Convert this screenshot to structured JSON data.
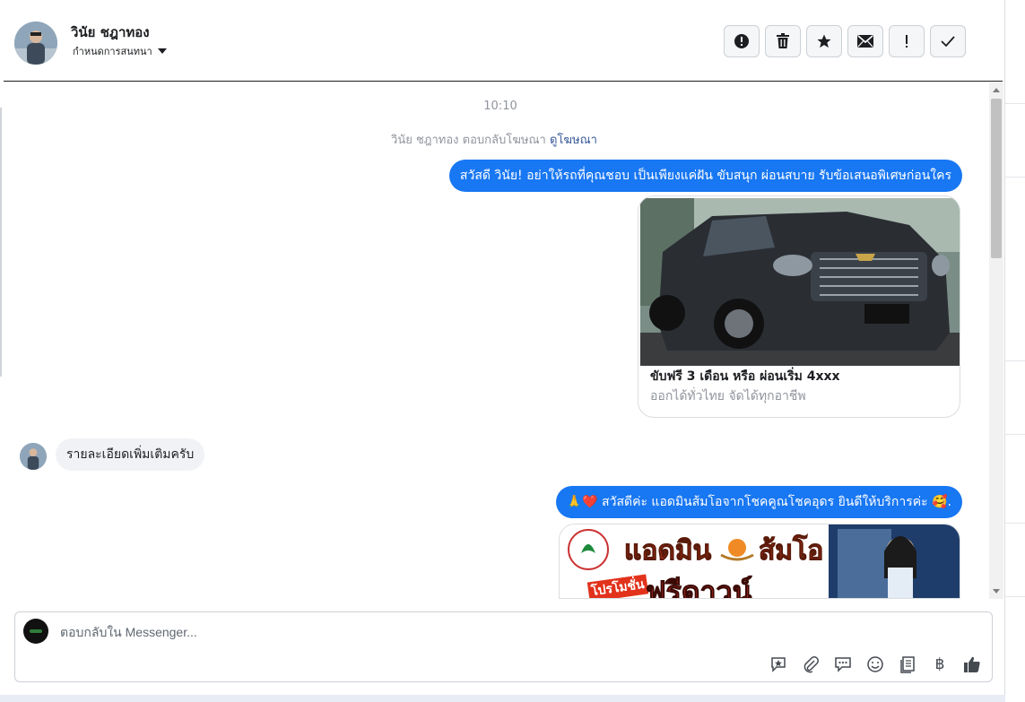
{
  "header": {
    "contact_name": "วินัย ชฎาทอง",
    "assign_label": "กำหนดการสนทนา",
    "tools": [
      {
        "icon": "alert-circle-icon"
      },
      {
        "icon": "trash-icon"
      },
      {
        "icon": "star-icon"
      },
      {
        "icon": "envelope-icon"
      },
      {
        "icon": "exclamation-icon"
      },
      {
        "icon": "check-icon"
      }
    ]
  },
  "conversation": {
    "time": "10:10",
    "ad_reply_text": "วินัย ชฎาทอง ตอบกลับโฆษณา",
    "ad_reply_link": "ดูโฆษณา",
    "messages": [
      {
        "text": "สวัสดี วินัย! อย่าให้รถที่คุณชอบ เป็นเพียงแค่ฝัน ขับสนุก ผ่อนสบาย รับข้อเสนอพิเศษก่อนใคร"
      },
      {
        "text": "รายละเอียดเพิ่มเติมครับ"
      },
      {
        "text": "🙏❤️ สวัสดีค่ะ แอดมินส้มโอจากโชคคูณโชคอุดร ยินดีให้บริการค่ะ 🥰."
      }
    ],
    "card": {
      "title": "ขับฟรี 3 เดือน หรือ ผ่อนเริ่ม 4xxx",
      "subtitle": "ออกได้ทั่วไทย จัดได้ทุกอาชีพ"
    },
    "banner": {
      "line1": "แอดมิน",
      "line1b": "ส้มโอ",
      "line2": "ฟรีดาวน์",
      "badge": "โปรโมชั่น"
    }
  },
  "composer": {
    "placeholder": "ตอบกลับใน Messenger...",
    "baht_symbol": "฿"
  },
  "colors": {
    "accent": "#1877f2",
    "incoming_bubble": "#f0f2f5"
  }
}
